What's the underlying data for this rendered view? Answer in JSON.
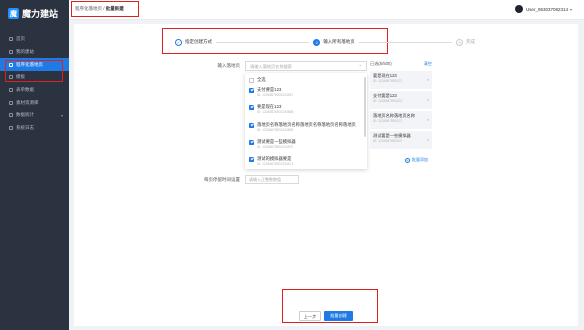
{
  "app": {
    "logo_mark": "魔",
    "name": "魔力建站"
  },
  "sidebar": {
    "items": [
      {
        "label": "首页",
        "icon": "home-icon",
        "active": false
      },
      {
        "label": "我的建站",
        "icon": "site-icon",
        "active": false
      },
      {
        "label": "程序化落地页",
        "icon": "program-icon",
        "active": true
      },
      {
        "label": "模板",
        "icon": "template-icon",
        "active": false
      },
      {
        "label": "表单数据",
        "icon": "form-icon",
        "active": false
      },
      {
        "label": "素材资源库",
        "icon": "asset-icon",
        "active": false
      },
      {
        "label": "数据统计",
        "icon": "chart-icon",
        "active": false,
        "caret": "▾"
      },
      {
        "label": "系统日志",
        "icon": "log-icon",
        "active": false
      }
    ]
  },
  "header": {
    "breadcrumb_parent": "程序化落地页",
    "breadcrumb_sep": " / ",
    "breadcrumb_current": "批量新建",
    "username": "User_953037082314",
    "caret": "▾"
  },
  "steps": [
    {
      "num": "✓",
      "label": "指定创建方式",
      "state": "done"
    },
    {
      "num": "2",
      "label": "输入所有落地页",
      "state": "current"
    },
    {
      "num": "3",
      "label": "完成",
      "state": "todo"
    }
  ],
  "form": {
    "url_label": "输入落地页",
    "url_placeholder": "请输入落地页名称搜索",
    "time_label": "每页停留时间设置",
    "time_placeholder": "请输入正整数数值"
  },
  "dropdown": {
    "items": [
      {
        "title": "全选",
        "sub": "",
        "checked": false
      },
      {
        "title": "支付要是123",
        "sub": "ID: 12345678901234567",
        "checked": true
      },
      {
        "title": "要是现在123",
        "sub": "ID: 12345678901234568",
        "checked": true
      },
      {
        "title": "落地页名称落地页名称落地页名称落地页名称落地页",
        "sub": "ID: 12345678901234569",
        "checked": true
      },
      {
        "title": "测试要是一些模拟器",
        "sub": "ID: 12345678901234570",
        "checked": true
      },
      {
        "title": "测试的模拟器要是",
        "sub": "ID: 12345678901234571",
        "checked": true
      }
    ]
  },
  "selected": {
    "header": "已选(5/500)",
    "clear_label": "清空",
    "items": [
      {
        "title": "要是现在123",
        "sub": "ID: 1234567890123"
      },
      {
        "title": "支付要是123",
        "sub": "ID: 1234567890123"
      },
      {
        "title": "落地页名称落地页名称",
        "sub": "ID: 1234567890123"
      },
      {
        "title": "测试要是一些模拟器",
        "sub": "ID: 1234567890123"
      }
    ],
    "add_label": "批量添加"
  },
  "buttons": {
    "prev": "上一步",
    "next": "批量创建"
  }
}
